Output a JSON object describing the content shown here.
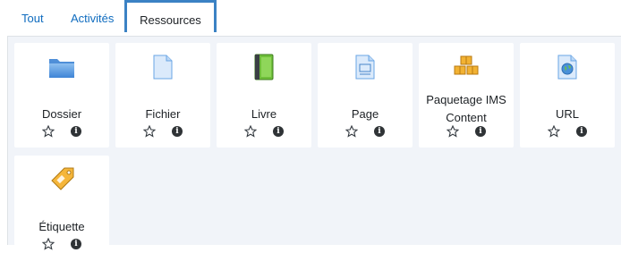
{
  "tabs": [
    {
      "label": "Tout"
    },
    {
      "label": "Activités"
    },
    {
      "label": "Ressources"
    }
  ],
  "active_tab": "Ressources",
  "accent_color": "#3b82c4",
  "link_color": "#0f6cbf",
  "modules": [
    {
      "name": "Dossier",
      "icon": "folder-icon"
    },
    {
      "name": "Fichier",
      "icon": "file-icon"
    },
    {
      "name": "Livre",
      "icon": "book-icon"
    },
    {
      "name": "Page",
      "icon": "page-icon"
    },
    {
      "name": "Paquetage IMS Content",
      "icon": "ims-package-icon"
    },
    {
      "name": "URL",
      "icon": "url-icon"
    },
    {
      "name": "Étiquette",
      "icon": "label-tag-icon"
    }
  ]
}
